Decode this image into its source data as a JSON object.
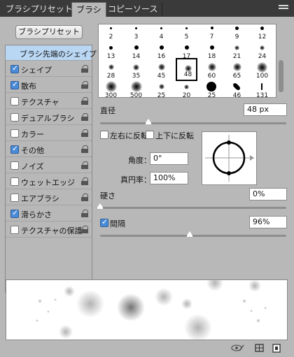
{
  "tabs": [
    {
      "label": "ブラシプリセット",
      "active": false
    },
    {
      "label": "ブラシ",
      "active": true
    },
    {
      "label": "コピーソース",
      "active": false
    }
  ],
  "preset_button": "ブラシプリセット",
  "options": [
    {
      "label": "ブラシ先端のシェイプ",
      "checkbox": false,
      "checked": false,
      "lock": false,
      "selected": true
    },
    {
      "label": "シェイプ",
      "checkbox": true,
      "checked": true,
      "lock": true
    },
    {
      "label": "散布",
      "checkbox": true,
      "checked": true,
      "lock": true
    },
    {
      "label": "テクスチャ",
      "checkbox": true,
      "checked": false,
      "lock": true
    },
    {
      "label": "デュアルブラシ",
      "checkbox": true,
      "checked": false,
      "lock": true
    },
    {
      "label": "カラー",
      "checkbox": true,
      "checked": false,
      "lock": true
    },
    {
      "label": "その他",
      "checkbox": true,
      "checked": true,
      "lock": true
    },
    {
      "label": "ノイズ",
      "checkbox": true,
      "checked": false,
      "lock": true
    },
    {
      "label": "ウェットエッジ",
      "checkbox": true,
      "checked": false,
      "lock": true
    },
    {
      "label": "エアブラシ",
      "checkbox": true,
      "checked": false,
      "lock": true
    },
    {
      "label": "滑らかさ",
      "checkbox": true,
      "checked": true,
      "lock": true
    },
    {
      "label": "テクスチャの保護",
      "checkbox": true,
      "checked": false,
      "lock": true
    }
  ],
  "brush_sizes": [
    [
      "2",
      "3",
      "4",
      "5",
      "7",
      "9",
      "12"
    ],
    [
      "13",
      "14",
      "16",
      "17",
      "18",
      "21",
      "24"
    ],
    [
      "28",
      "35",
      "45",
      "48",
      "60",
      "65",
      "100"
    ],
    [
      "300",
      "500",
      "25",
      "20",
      "25",
      "46",
      "131"
    ]
  ],
  "selected_brush": "48",
  "size": {
    "label": "直径",
    "value": "48 px",
    "fraction": 0.26
  },
  "flip_x": {
    "label": "左右に反転",
    "checked": false
  },
  "flip_y": {
    "label": "上下に反転",
    "checked": false
  },
  "angle": {
    "label": "角度：",
    "value": "0°"
  },
  "roundness": {
    "label": "真円率：",
    "value": "100%"
  },
  "hardness": {
    "label": "硬さ",
    "value": "0%",
    "fraction": 0.0
  },
  "spacing": {
    "label": "間隔",
    "value": "96%",
    "checked": true,
    "fraction": 0.48
  },
  "colors": {
    "accent": "#4a8bd8",
    "selected_row": "#b9d6f2",
    "panel": "#b8b8b8",
    "tabbar": "#3a3a3a"
  },
  "icons": [
    "eye-brush-icon",
    "grid-icon",
    "new-preset-icon",
    "panel-menu-icon"
  ]
}
